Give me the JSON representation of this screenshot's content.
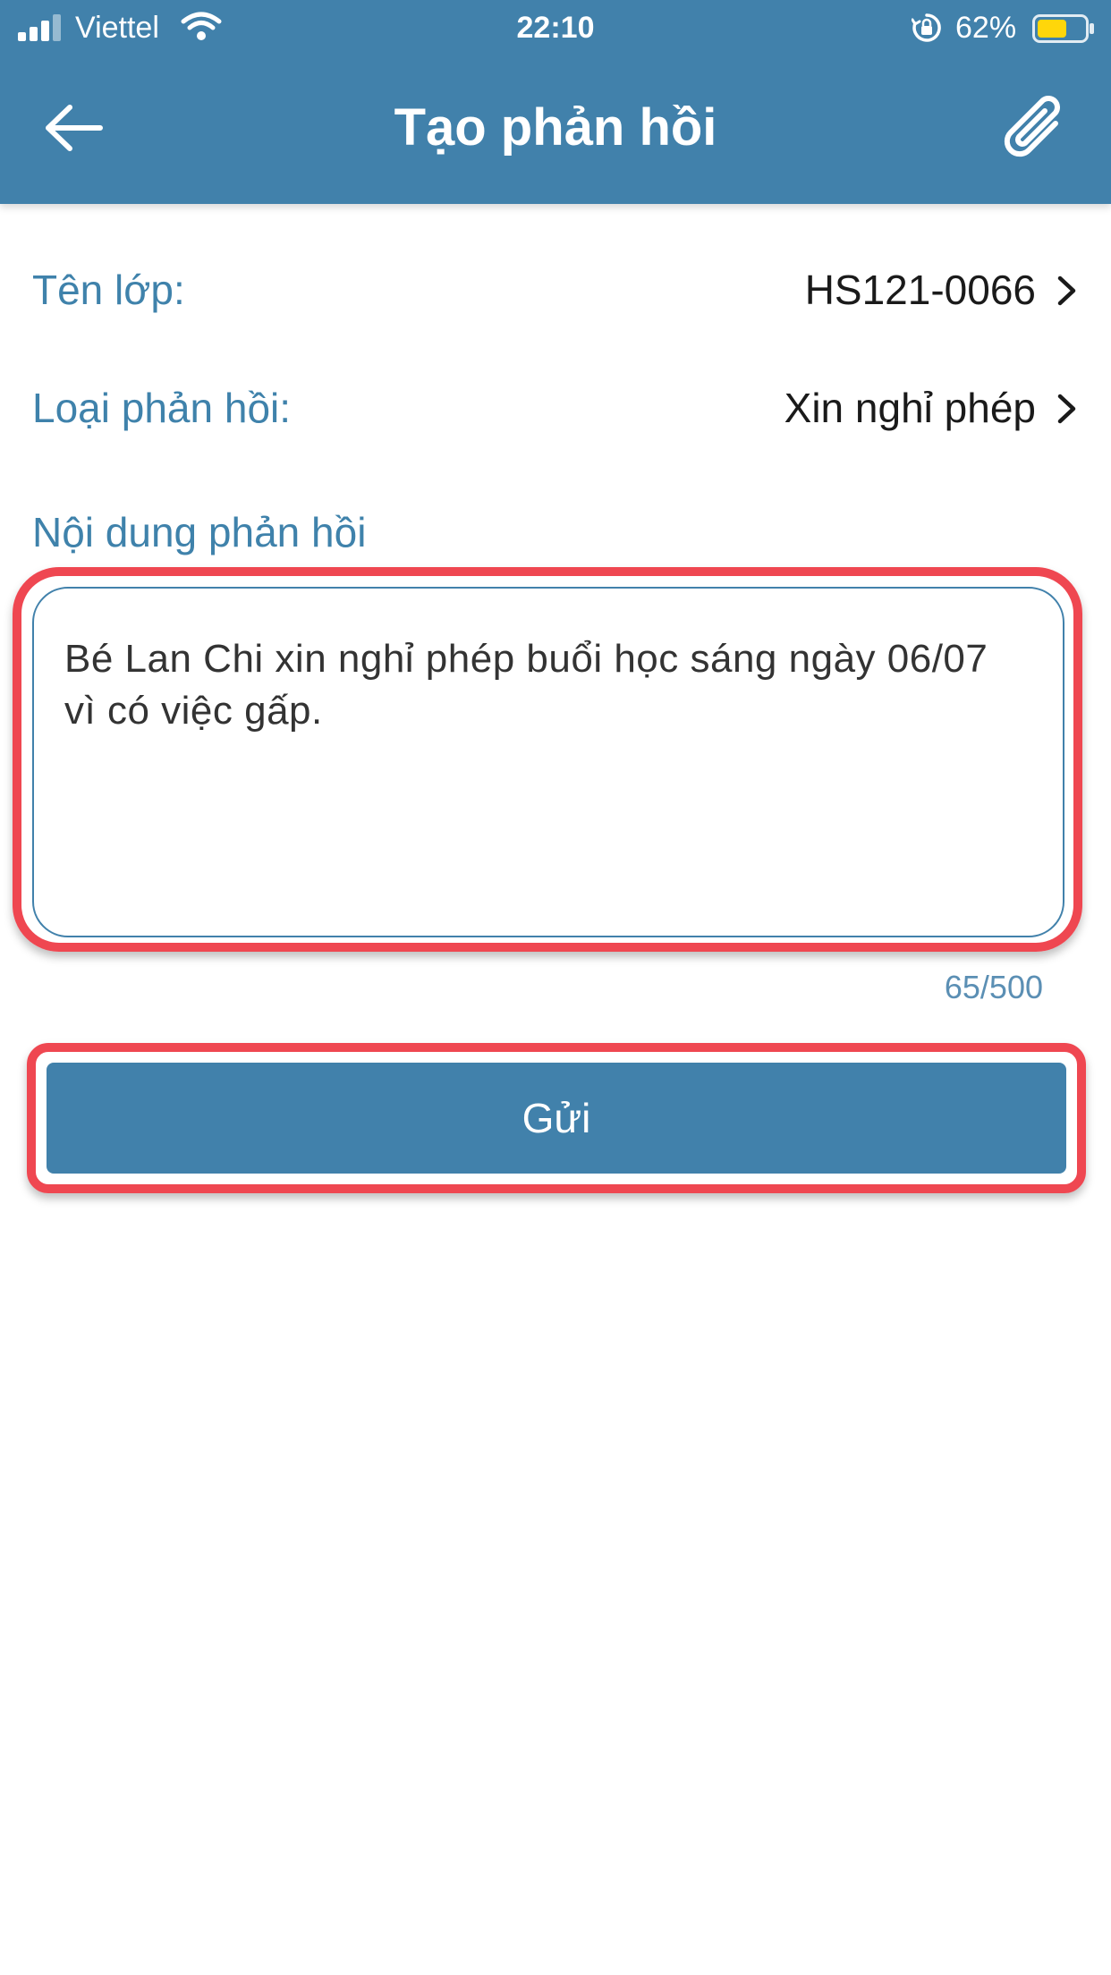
{
  "status_bar": {
    "carrier": "Viettel",
    "time": "22:10",
    "battery_percent": "62%",
    "battery_level": 0.62,
    "signal_bars": 3,
    "battery_color": "#ffd60a"
  },
  "header": {
    "title": "Tạo phản hồi",
    "back_icon": "arrow-left-icon",
    "attach_icon": "paperclip-icon"
  },
  "form": {
    "class_row": {
      "label": "Tên lớp:",
      "value": "HS121-0066"
    },
    "type_row": {
      "label": "Loại phản hồi:",
      "value": "Xin nghỉ phép"
    },
    "content_label": "Nội dung phản hồi",
    "content_value": "Bé Lan Chi xin nghỉ phép buổi học sáng ngày 06/07 vì có việc gấp.",
    "counter": "65/500",
    "submit_label": "Gửi"
  },
  "colors": {
    "primary": "#4181ab",
    "highlight": "#ef4751",
    "label": "#3f82ab"
  }
}
